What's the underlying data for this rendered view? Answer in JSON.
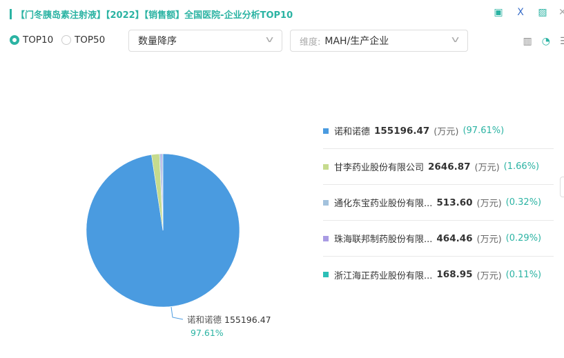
{
  "header": {
    "title": "【门冬胰岛素注射液】【2022】【销售额】全国医院-企业分析TOP10",
    "icons": [
      "file-search-icon",
      "excel-export-icon",
      "image-export-icon",
      "close-icon"
    ]
  },
  "controls": {
    "top10": "TOP10",
    "top50": "TOP50",
    "selected": "TOP10",
    "sort": "数量降序",
    "dimension_label": "维度:",
    "dimension_value": "MAH/生产企业",
    "view_icons": [
      "bar-chart-icon",
      "pie-chart-icon",
      "table-icon"
    ]
  },
  "chart_data": {
    "type": "pie",
    "unit": "(万元)",
    "slices": [
      {
        "name": "诺和诺德",
        "value": 155196.47,
        "percent": "97.61%",
        "color": "#4a9be0"
      },
      {
        "name": "甘李药业股份有限公司",
        "value": 2646.87,
        "percent": "1.66%",
        "color": "#c6db8e"
      },
      {
        "name": "通化东宝药业股份有限...",
        "value": 513.6,
        "percent": "0.32%",
        "color": "#a3c2dd"
      },
      {
        "name": "珠海联邦制药股份有限...",
        "value": 464.46,
        "percent": "0.29%",
        "color": "#a99be3"
      },
      {
        "name": "浙江海正药业股份有限...",
        "value": 168.95,
        "percent": "0.11%",
        "color": "#2cbfb7"
      }
    ],
    "label": {
      "name": "诺和诺德",
      "value": "155196.47",
      "percent": "97.61%"
    }
  }
}
